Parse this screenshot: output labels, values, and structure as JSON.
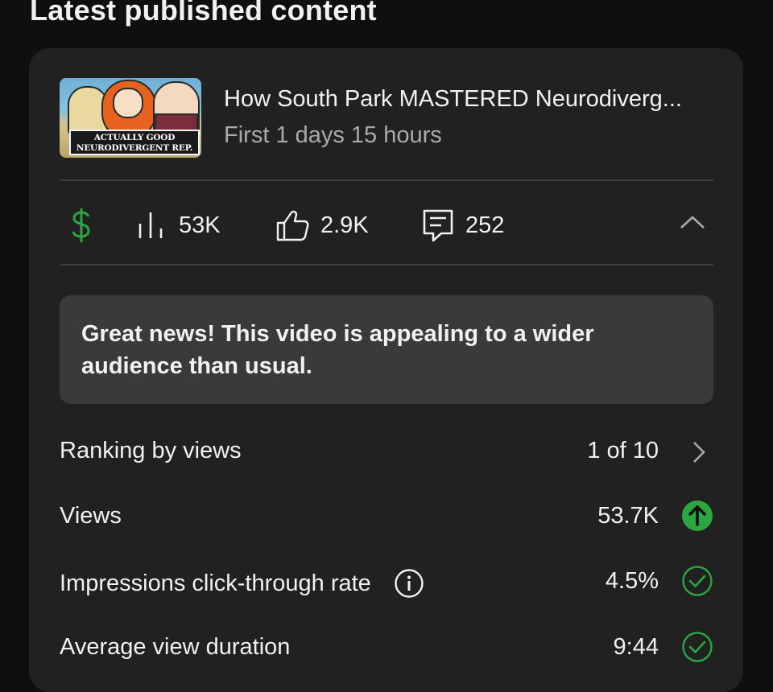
{
  "section": {
    "title": "Latest published content"
  },
  "video": {
    "title": "How South Park MASTERED Neurodiverg...",
    "subtitle": "First 1 days 15 hours",
    "thumbnail_caption_line1": "ACTUALLY GOOD",
    "thumbnail_caption_line2": "NEURODIVERGENT REP."
  },
  "stats": {
    "monetization_icon": "dollar-icon",
    "views": "53K",
    "likes": "2.9K",
    "comments": "252",
    "accent_green": "#2ba640"
  },
  "banner": {
    "text": "Great news! This video is appealing to a wider audience than usual."
  },
  "metrics": [
    {
      "label": "Ranking by views",
      "value": "1 of 10",
      "icon": "chevron-right-icon"
    },
    {
      "label": "Views",
      "value": "53.7K",
      "icon": "arrow-up-circle-icon"
    },
    {
      "label": "Impressions click-through rate",
      "value": "4.5%",
      "icon": "check-circle-icon",
      "info_icon": "info-icon"
    },
    {
      "label": "Average view duration",
      "value": "9:44",
      "icon": "check-circle-icon"
    }
  ]
}
